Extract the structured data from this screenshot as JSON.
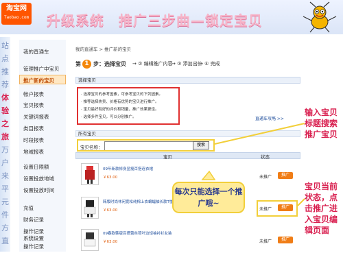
{
  "banner": {
    "logo_text": "淘宝网",
    "logo_sub": "Taobao.com",
    "headline": "升级系统　推广三步曲—锁定宝贝",
    "mascot_icon": "ant-mascot-icon"
  },
  "left_strip": {
    "chars": [
      "站",
      "点",
      "推",
      "荐",
      "体",
      "验",
      "之",
      "旅",
      "万",
      "户",
      "来",
      "平",
      "元",
      "件",
      "方",
      "直"
    ],
    "highlight_color": "#d92050"
  },
  "sidebar": {
    "items": [
      {
        "label": "我的直通车"
      },
      {
        "label": "管理推广中宝贝"
      },
      {
        "label": "推广新的宝贝",
        "selected": true
      },
      {
        "label": "帐户报表"
      },
      {
        "label": "宝贝报表"
      },
      {
        "label": "关键词报表"
      },
      {
        "label": "类目报表"
      },
      {
        "label": "时段报表"
      },
      {
        "label": "地域报表"
      },
      {
        "label": "设置日限额"
      },
      {
        "label": "设置投放地域"
      },
      {
        "label": "设置投放时间"
      },
      {
        "label": "充值"
      },
      {
        "label": "财务记录"
      },
      {
        "label": "操作记录"
      },
      {
        "label": "系统设置"
      },
      {
        "label": "操作记录"
      }
    ]
  },
  "main": {
    "breadcrumb": "我的直通车 > 推广新的宝贝",
    "step_prefix": "第",
    "step_number": "1",
    "step_suffix": "步：选择宝贝",
    "steps": [
      "→ ② 编辑推广内容",
      "→ ③ 添加出价",
      "→ ④ 完成"
    ],
    "panel_title": "选择宝贝",
    "tips": [
      "· 选择宝贝的参考因素，可参考宝贝的下列因素。",
      "· 推荐选择热卖、价格有优势的宝贝进行推广。",
      "· 宝贝最好有好的评价和销量，推广效果更佳。",
      "· 选择多件宝贝，可以分别推广。"
    ],
    "more_link": "直通车攻略 >>",
    "section_title": "所有宝贝",
    "search_label": "宝贝名称：",
    "search_value": "",
    "search_button": "搜索",
    "columns": [
      "宝贝",
      "状态"
    ],
    "products": [
      {
        "title": "09年新款修身显瘦百搭连衣裙",
        "price": "￥63.00",
        "status": "未推广",
        "action": "推广"
      },
      {
        "title": "韩版时尚休闲宽松纯棉上衣蝙蝠袖长款T恤",
        "price": "￥63.00",
        "status": "未推广",
        "action": "推广"
      },
      {
        "title": "09春款韩版百搭蕾丝荷叶边短袖衬衫女装",
        "price": "￥63.00",
        "status": "未推广",
        "action": "推广"
      }
    ]
  },
  "annotations": {
    "bubble_text": "每次只能选择一个推广哦~",
    "callout_search": "输入宝贝\n标题搜索\n推广宝贝",
    "callout_status": "宝贝当前\n状态，点\n击推广进\n入宝贝编\n辑页面",
    "accent_red": "#e03030",
    "accent_yellow": "#f2cf3a",
    "accent_orange": "#f07d16"
  }
}
